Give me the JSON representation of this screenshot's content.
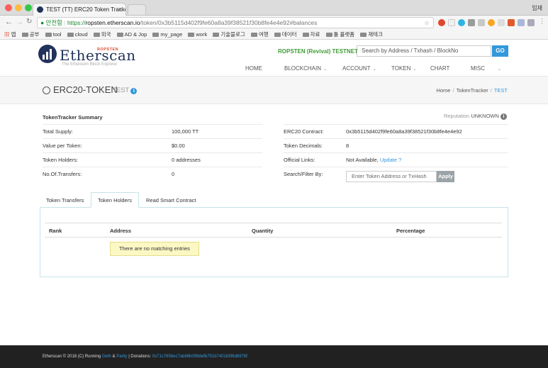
{
  "browser": {
    "tab_title": "TEST (TT) ERC20 Token Tracke",
    "tab_close": "×",
    "user_label": "임재",
    "url_secure": "안전함",
    "url_scheme": "https://",
    "url_host": "ropsten.etherscan.io",
    "url_path": "/token/0x3b5115d402f9fe60a8a39f38521f30b8fe4e4e92#balances",
    "bookmarks": [
      "앱",
      "공부",
      "tool",
      "cloud",
      "외국",
      "AD & Jop",
      "my_page",
      "work",
      "기술블로그",
      "여행",
      "데이터",
      "자료",
      "툴 플랫폼",
      "재테크"
    ]
  },
  "header": {
    "logo_text": "Etherscan",
    "network_tag": "ROPSTEN",
    "tagline": "The Ethereum Block Explorer",
    "testnet_label": "ROPSTEN (Revival) TESTNET",
    "search_placeholder": "Search by Address / Txhash / BlockNo",
    "go_label": "GO",
    "menu": [
      "HOME",
      "BLOCKCHAIN",
      "ACCOUNT",
      "TOKEN",
      "CHART",
      "MISC"
    ]
  },
  "title": {
    "main": "ERC20-TOKEN",
    "sub": "TEST",
    "breadcrumb": [
      "Home",
      "TokenTracker",
      "TEST"
    ]
  },
  "summary": {
    "heading": "TokenTracker Summary",
    "reputation_label": "Reputation",
    "reputation_value": "UNKNOWN",
    "left": [
      {
        "label": "Total Supply:",
        "value": "100,000 TT"
      },
      {
        "label": "Value per Token:",
        "value": "$0.00"
      },
      {
        "label": "Token Holders:",
        "value": "0 addresses"
      },
      {
        "label": "No.Of.Transfers:",
        "value": "0"
      }
    ],
    "contract_label": "ERC20 Contract:",
    "contract_value": "0x3b5115d402f9fe60a8a39f38521f30b8fe4e4e92",
    "decimals_label": "Token Decimals:",
    "decimals_value": "8",
    "links_label": "Official Links:",
    "links_value": "Not Available,",
    "links_update": "Update",
    "links_q": "?",
    "filter_label": "Search/Filter By:",
    "filter_placeholder": "Enter Token Address or TxHash",
    "apply_label": "Apply"
  },
  "tabs": [
    "Token Transfers",
    "Token Holders",
    "Read Smart Contract"
  ],
  "table": {
    "headers": [
      "Rank",
      "Address",
      "Quantity",
      "Percentage"
    ],
    "empty_message": "There are no matching entries"
  },
  "footer": {
    "prefix": "Etherscan © 2018 (C) Running",
    "geth": "Geth",
    "amp": "&",
    "parity": "Parity",
    "donations_label": "| Donations:",
    "donations_address": "0x71c7656ec7ab88b098defb751b7401b5f6d8976f"
  },
  "colors": {
    "brand": "#21325b",
    "accent": "#3498db",
    "testnet": "#3d9b35",
    "footer_bg": "#212121"
  }
}
